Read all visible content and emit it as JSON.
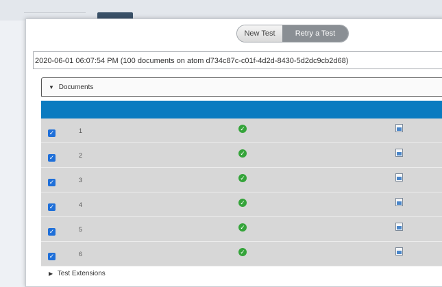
{
  "segmented": {
    "new_label": "New Test",
    "retry_label": "Retry a Test"
  },
  "run_selector": {
    "value": "2020-06-01 06:07:54 PM (100 documents on atom d734c87c-c01f-4d2d-8430-5d2dc9cb2d68)"
  },
  "documents_panel": {
    "title": "Documents"
  },
  "rows": [
    {
      "num": "1",
      "checked": true,
      "status": "ok"
    },
    {
      "num": "2",
      "checked": true,
      "status": "ok"
    },
    {
      "num": "3",
      "checked": true,
      "status": "ok"
    },
    {
      "num": "4",
      "checked": true,
      "status": "ok"
    },
    {
      "num": "5",
      "checked": true,
      "status": "ok"
    },
    {
      "num": "6",
      "checked": true,
      "status": "ok"
    }
  ],
  "extensions_panel": {
    "title": "Test Extensions"
  },
  "icons": {
    "check": "check-circle-icon",
    "doc": "document-icon"
  },
  "colors": {
    "header_blue": "#0a7bc0",
    "check_green": "#35a43a",
    "checkbox_blue": "#1e6fd9"
  }
}
